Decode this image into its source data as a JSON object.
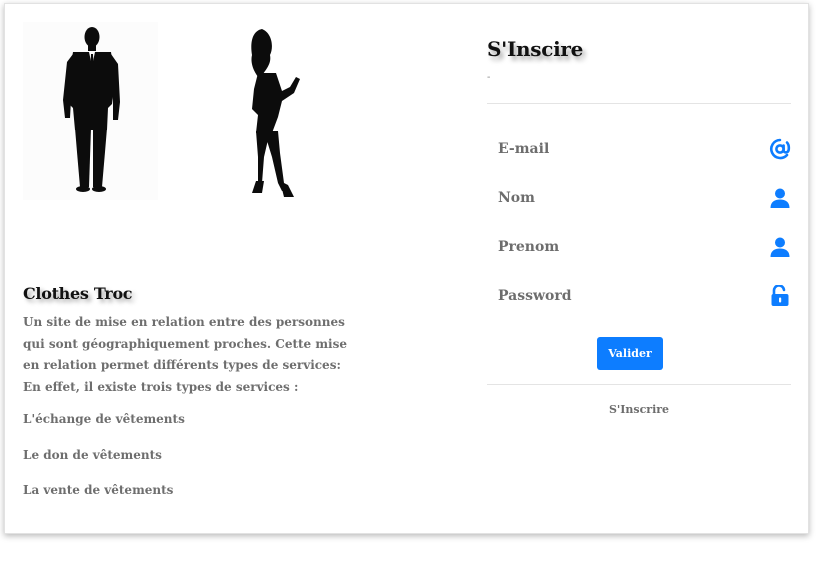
{
  "left": {
    "brand_title": "Clothes Troc",
    "description": "Un site de mise en relation entre des personnes qui sont géographiquement proches. Cette mise en relation permet différents types de services: En effet, il existe trois types de services :",
    "services": [
      {
        "label": "L'échange de vêtements"
      },
      {
        "label": "Le don de vêtements"
      },
      {
        "label": "La vente de vêtements"
      }
    ]
  },
  "form": {
    "title": "S'Inscire",
    "subtitle": "-",
    "fields": [
      {
        "label": "E-mail",
        "icon": "at-icon"
      },
      {
        "label": "Nom",
        "icon": "user-icon"
      },
      {
        "label": "Prenom",
        "icon": "user-icon"
      },
      {
        "label": "Password",
        "icon": "unlock-icon"
      }
    ],
    "submit_label": "Valider",
    "footer_link": "S'Inscrire"
  },
  "colors": {
    "accent": "#0d7dff",
    "text_muted": "#6d6d6d",
    "heading": "#111111"
  }
}
